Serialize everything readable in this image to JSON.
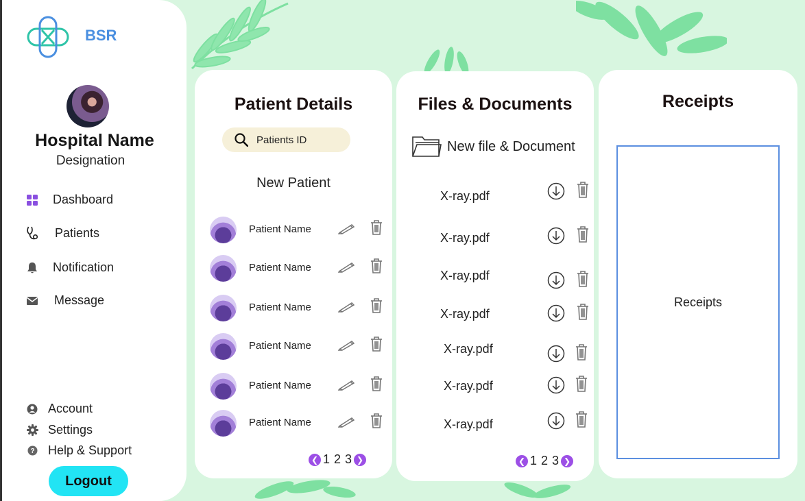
{
  "brand": {
    "name": "BSR"
  },
  "profile": {
    "hospital_name": "Hospital Name",
    "designation": "Designation"
  },
  "nav": {
    "items": [
      {
        "label": "Dashboard",
        "icon": "dashboard-icon"
      },
      {
        "label": "Patients",
        "icon": "stethoscope-icon"
      },
      {
        "label": "Notification",
        "icon": "bell-icon"
      },
      {
        "label": "Message",
        "icon": "mail-icon"
      }
    ]
  },
  "bottom_nav": {
    "items": [
      {
        "label": "Account",
        "icon": "account-icon"
      },
      {
        "label": "Settings",
        "icon": "gear-icon"
      },
      {
        "label": "Help & Support",
        "icon": "help-icon"
      }
    ],
    "logout_label": "Logout"
  },
  "patients": {
    "title": "Patient Details",
    "search_placeholder": "Patients ID",
    "new_patient_label": "New Patient",
    "rows": [
      {
        "name": "Patient Name"
      },
      {
        "name": "Patient Name"
      },
      {
        "name": "Patient Name"
      },
      {
        "name": "Patient Name"
      },
      {
        "name": "Patient Name"
      },
      {
        "name": "Patient Name"
      }
    ],
    "pages": [
      "1",
      "2",
      "3"
    ]
  },
  "files": {
    "title": "Files & Documents",
    "new_file_label": "New file & Document",
    "rows": [
      {
        "name": "X-ray.pdf"
      },
      {
        "name": "X-ray.pdf"
      },
      {
        "name": "X-ray.pdf"
      },
      {
        "name": "X-ray.pdf"
      },
      {
        "name": "X-ray.pdf"
      },
      {
        "name": "X-ray.pdf"
      },
      {
        "name": "X-ray.pdf"
      }
    ],
    "pages": [
      "1",
      "2",
      "3"
    ]
  },
  "receipts": {
    "title": "Receipts",
    "box_label": "Receipts"
  },
  "colors": {
    "background": "#d8f6e0",
    "leaf": "#7ee0a1",
    "brand": "#4a8fe0",
    "logout": "#22e4f4",
    "pager": "#9c4fe6",
    "search_bg": "#f6f0d9",
    "dashboard_icon": "#8a4fe0"
  }
}
